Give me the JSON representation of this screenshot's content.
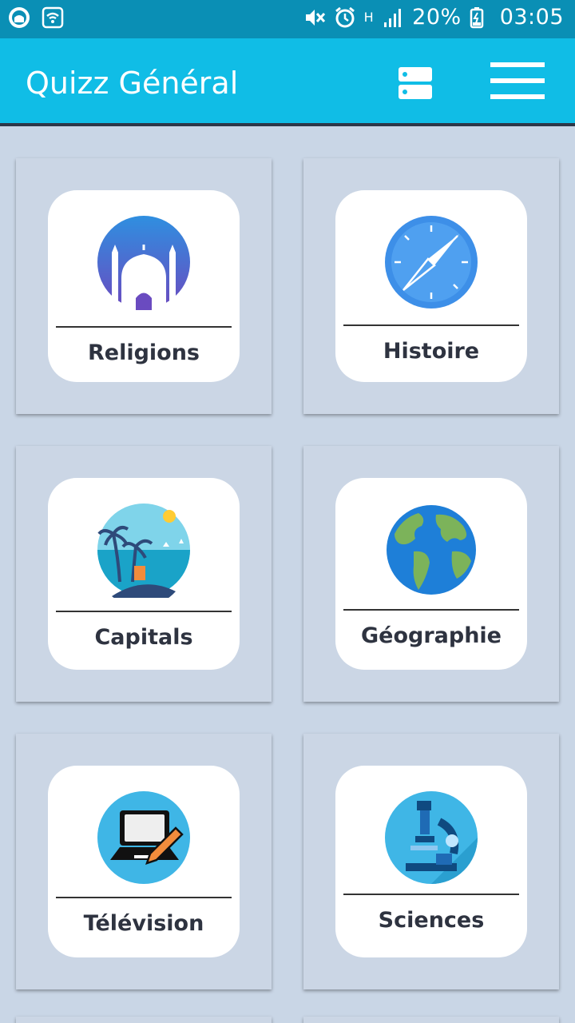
{
  "status_bar": {
    "battery": "20%",
    "time": "03:05",
    "network": "H",
    "icons": [
      "app-icon",
      "wifi-icon",
      "mute-icon",
      "alarm-icon",
      "signal-icon",
      "battery-icon"
    ]
  },
  "app_bar": {
    "title": "Quizz Général",
    "actions": [
      "list-icon",
      "menu-icon"
    ],
    "color": "#10bde6"
  },
  "categories": [
    {
      "label": "Religions",
      "icon": "mosque-icon"
    },
    {
      "label": "Histoire",
      "icon": "compass-icon"
    },
    {
      "label": "Capitals",
      "icon": "beach-icon"
    },
    {
      "label": "Géographie",
      "icon": "globe-icon"
    },
    {
      "label": "Télévision",
      "icon": "laptop-icon"
    },
    {
      "label": "Sciences",
      "icon": "microscope-icon"
    }
  ]
}
